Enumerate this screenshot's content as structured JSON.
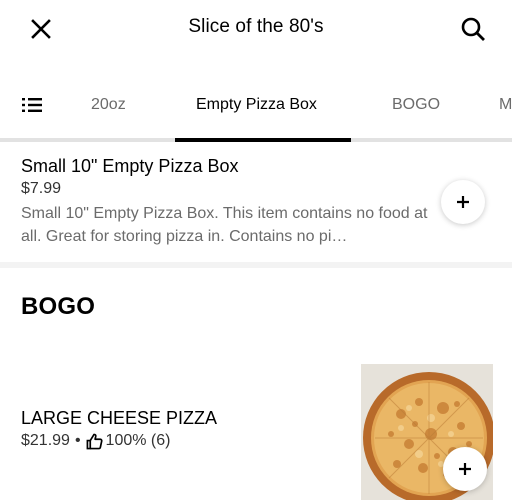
{
  "header": {
    "title": "Slice of the 80's",
    "close_icon": "close-icon",
    "search_icon": "search-icon"
  },
  "tabs": {
    "menu_icon": "list-icon",
    "items": [
      {
        "label": "20oz",
        "active": false
      },
      {
        "label": "Empty Pizza Box",
        "active": true
      },
      {
        "label": "BOGO",
        "active": false
      },
      {
        "label": "M",
        "active": false
      }
    ]
  },
  "items": [
    {
      "title": "Small 10\" Empty Pizza Box",
      "price": "$7.99",
      "description": "Small 10\" Empty Pizza Box. This item contains no food at all. Great for storing pizza in. Contains no pi…",
      "add_icon": "plus-icon"
    }
  ],
  "section": {
    "title": "BOGO",
    "items": [
      {
        "title": "LARGE CHEESE PIZZA",
        "price": "$21.99",
        "separator": "•",
        "rating_icon": "thumbs-up-icon",
        "rating": "100% (6)",
        "image": "cheese-pizza-photo",
        "add_icon": "plus-icon"
      }
    ]
  }
}
